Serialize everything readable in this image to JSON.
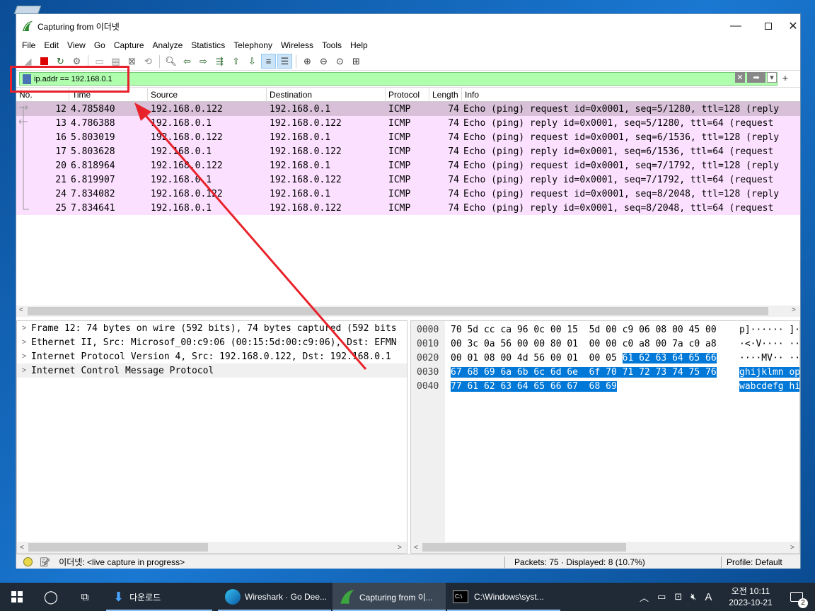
{
  "window": {
    "title": "Capturing from 이더넷"
  },
  "menu": [
    "File",
    "Edit",
    "View",
    "Go",
    "Capture",
    "Analyze",
    "Statistics",
    "Telephony",
    "Wireless",
    "Tools",
    "Help"
  ],
  "toolbar_icons": [
    "shark-fin-start-icon",
    "stop-icon",
    "restart-icon",
    "options-gear-icon",
    "open-file-icon",
    "save-file-icon",
    "close-file-icon",
    "reload-icon",
    "find-icon",
    "go-back-icon",
    "go-forward-icon",
    "go-to-packet-icon",
    "go-first-icon",
    "go-last-icon",
    "autoscroll-icon",
    "colorize-icon",
    "zoom-in-icon",
    "zoom-out-icon",
    "zoom-normal-icon",
    "resize-columns-icon"
  ],
  "filter": {
    "value": "ip.addr == 192.168.0.1",
    "plus": "+"
  },
  "columns": [
    "No.",
    "Time",
    "Source",
    "Destination",
    "Protocol",
    "Length",
    "Info"
  ],
  "packets": [
    {
      "no": "12",
      "time": "4.785840",
      "src": "192.168.0.122",
      "dst": "192.168.0.1",
      "proto": "ICMP",
      "len": "74",
      "info": "Echo (ping) request  id=0x0001, seq=5/1280, ttl=128 (reply"
    },
    {
      "no": "13",
      "time": "4.786388",
      "src": "192.168.0.1",
      "dst": "192.168.0.122",
      "proto": "ICMP",
      "len": "74",
      "info": "Echo (ping) reply    id=0x0001, seq=5/1280, ttl=64 (request"
    },
    {
      "no": "16",
      "time": "5.803019",
      "src": "192.168.0.122",
      "dst": "192.168.0.1",
      "proto": "ICMP",
      "len": "74",
      "info": "Echo (ping) request  id=0x0001, seq=6/1536, ttl=128 (reply"
    },
    {
      "no": "17",
      "time": "5.803628",
      "src": "192.168.0.1",
      "dst": "192.168.0.122",
      "proto": "ICMP",
      "len": "74",
      "info": "Echo (ping) reply    id=0x0001, seq=6/1536, ttl=64 (request"
    },
    {
      "no": "20",
      "time": "6.818964",
      "src": "192.168.0.122",
      "dst": "192.168.0.1",
      "proto": "ICMP",
      "len": "74",
      "info": "Echo (ping) request  id=0x0001, seq=7/1792, ttl=128 (reply"
    },
    {
      "no": "21",
      "time": "6.819907",
      "src": "192.168.0.1",
      "dst": "192.168.0.122",
      "proto": "ICMP",
      "len": "74",
      "info": "Echo (ping) reply    id=0x0001, seq=7/1792, ttl=64 (request"
    },
    {
      "no": "24",
      "time": "7.834082",
      "src": "192.168.0.122",
      "dst": "192.168.0.1",
      "proto": "ICMP",
      "len": "74",
      "info": "Echo (ping) request  id=0x0001, seq=8/2048, ttl=128 (reply"
    },
    {
      "no": "25",
      "time": "7.834641",
      "src": "192.168.0.1",
      "dst": "192.168.0.122",
      "proto": "ICMP",
      "len": "74",
      "info": "Echo (ping) reply    id=0x0001, seq=8/2048, ttl=64 (request"
    }
  ],
  "details": [
    "Frame 12: 74 bytes on wire (592 bits), 74 bytes captured (592 bits",
    "Ethernet II, Src: Microsof_00:c9:06 (00:15:5d:00:c9:06), Dst: EFMN",
    "Internet Protocol Version 4, Src: 192.168.0.122, Dst: 192.168.0.1",
    "Internet Control Message Protocol"
  ],
  "bytes": [
    {
      "off": "0000",
      "hexA": "70 5d cc ca 96 0c 00 15  5d 00 c9 06 08 00 45 00",
      "hexB": "",
      "asciiA": "p]······ ]·",
      "asciiB": ""
    },
    {
      "off": "0010",
      "hexA": "00 3c 0a 56 00 00 80 01  00 00 c0 a8 00 7a c0 a8",
      "hexB": "",
      "asciiA": "·<·V···· ···",
      "asciiB": ""
    },
    {
      "off": "0020",
      "hexA": "00 01 08 00 4d 56 00 01  00 05 ",
      "hexB": "61 62 63 64 65 66",
      "asciiA": "····MV·· ··",
      "asciiB": ""
    },
    {
      "off": "0030",
      "hexA": "",
      "hexB": "67 68 69 6a 6b 6c 6d 6e  6f 70 71 72 73 74 75 76",
      "asciiA": "",
      "asciiB": "ghijklmn op"
    },
    {
      "off": "0040",
      "hexA": "",
      "hexB": "77 61 62 63 64 65 66 67  68 69",
      "asciiA": "",
      "asciiB": "wabcdefg hi"
    }
  ],
  "status": {
    "capture": "이더넷: <live capture in progress>",
    "packets": "Packets: 75 · Displayed: 8 (10.7%)",
    "profile": "Profile: Default"
  },
  "taskbar": {
    "items": [
      "다운로드",
      "Wireshark · Go Dee...",
      "Capturing from 이...",
      "C:\\Windows\\syst..."
    ],
    "time": "오전 10:11",
    "date": "2023-10-21",
    "ime": "A",
    "notif_count": "2"
  },
  "colors": {
    "filter_ok": "#afffaf",
    "icmp_row": "#fce0ff",
    "selected_row": "#d7c0d8",
    "annotation_red": "#e8222a",
    "taskbar": "#1f2a36"
  }
}
